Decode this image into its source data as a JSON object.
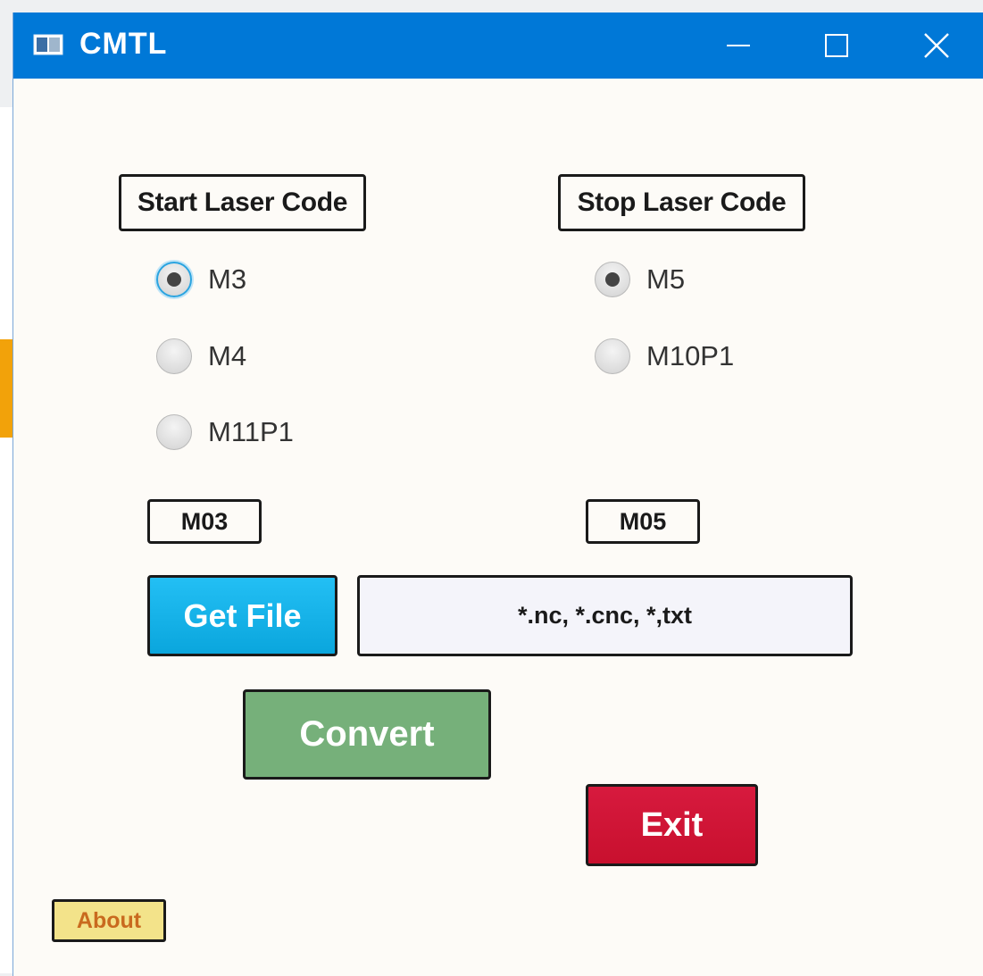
{
  "window": {
    "title": "CMTL"
  },
  "start_laser": {
    "header": "Start Laser Code",
    "options": [
      {
        "label": "M3",
        "selected": true
      },
      {
        "label": "M4",
        "selected": false
      },
      {
        "label": "M11P1",
        "selected": false
      }
    ],
    "code": "M03"
  },
  "stop_laser": {
    "header": "Stop Laser Code",
    "options": [
      {
        "label": "M5",
        "selected": true
      },
      {
        "label": "M10P1",
        "selected": false
      }
    ],
    "code": "M05"
  },
  "file": {
    "button_label": "Get File",
    "field_text": "*.nc, *.cnc, *,txt"
  },
  "actions": {
    "convert_label": "Convert",
    "exit_label": "Exit",
    "about_label": "About"
  },
  "colors": {
    "titlebar": "#0078d7",
    "get_file": "#0aa6dd",
    "convert": "#76b07a",
    "exit": "#c8102e",
    "about": "#f3e38a"
  }
}
